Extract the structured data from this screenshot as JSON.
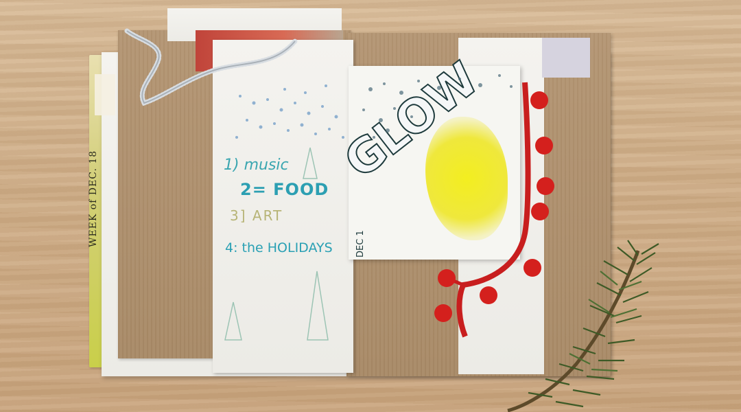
{
  "journal": {
    "side_strip_text": "WEEK of DEC. 18",
    "list": [
      "1) music",
      "2= FOOD",
      "3] ART",
      "4: the HOLIDAYS"
    ],
    "page_word": "GLOW",
    "page_date": "DEC 1"
  },
  "palette": {
    "wood": "#cfae88",
    "kraft": "#a88a67",
    "paper": "#f1f0ec",
    "pompom_red": "#d61f1f",
    "accent_teal": "#2c9fb2",
    "yellow_paint": "#f2ec2a",
    "pine": "#3f5a28"
  },
  "objects": {
    "tinsel": "silver-tinsel",
    "trim": "red-pompom-trim",
    "branch": "pine-branch-icon",
    "glitter": "star-confetti"
  }
}
